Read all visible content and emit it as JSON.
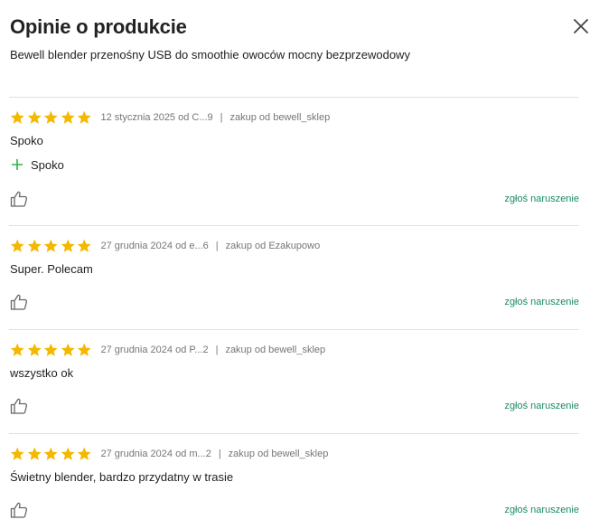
{
  "header": {
    "title": "Opinie o produkcie",
    "subtitle": "Bewell blender przenośny USB do smoothie owoców mocny bezprzewodowy"
  },
  "colors": {
    "star": "#f5b800",
    "link": "#1a8a6a",
    "pro_plus": "#2eb34a",
    "divider": "#e0e0e0"
  },
  "icons": {
    "close": "close-icon",
    "star": "star-icon",
    "plus": "plus-icon",
    "thumb": "thumbs-up-icon"
  },
  "reviews": [
    {
      "rating": 5,
      "date_author": "12 stycznia 2025 od C...9",
      "purchase": "zakup od bewell_sklep",
      "text": "Spoko",
      "pros": "Spoko",
      "report_label": "zgłoś naruszenie"
    },
    {
      "rating": 5,
      "date_author": "27 grudnia 2024 od e...6",
      "purchase": "zakup od Ezakupowo",
      "text": "Super. Polecam",
      "report_label": "zgłoś naruszenie"
    },
    {
      "rating": 5,
      "date_author": "27 grudnia 2024 od P...2",
      "purchase": "zakup od bewell_sklep",
      "text": "wszystko ok",
      "report_label": "zgłoś naruszenie"
    },
    {
      "rating": 5,
      "date_author": "27 grudnia 2024 od m...2",
      "purchase": "zakup od bewell_sklep",
      "text": "Świetny blender, bardzo przydatny w trasie",
      "report_label": "zgłoś naruszenie"
    }
  ]
}
